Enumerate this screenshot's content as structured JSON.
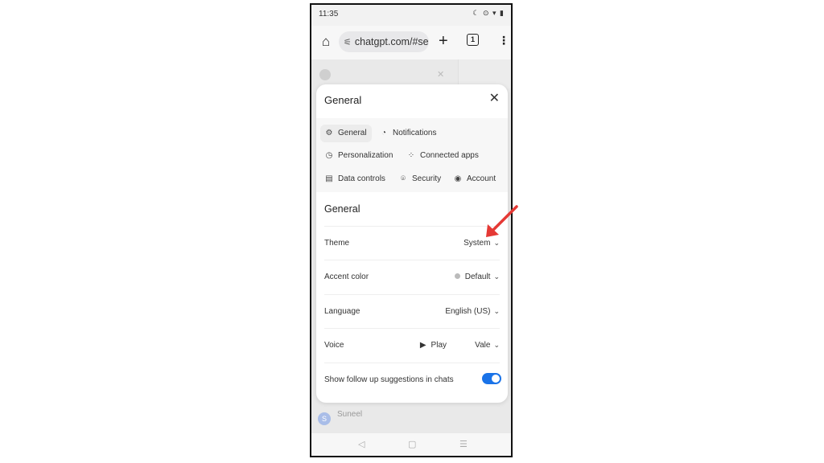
{
  "status_bar": {
    "time": "11:35",
    "icons": "☾ ⊙ ▾ ▮"
  },
  "browser": {
    "url": "chatgpt.com/#se",
    "tab_count": "1"
  },
  "modal": {
    "title": "General",
    "tabs": [
      {
        "label": "General",
        "icon": "gear-icon",
        "glyph": "⚙"
      },
      {
        "label": "Notifications",
        "icon": "bell-icon",
        "glyph": "🔔︎"
      },
      {
        "label": "Personalization",
        "icon": "clock-icon",
        "glyph": "◷"
      },
      {
        "label": "Connected apps",
        "icon": "apps-icon",
        "glyph": "⁘"
      },
      {
        "label": "Data controls",
        "icon": "database-icon",
        "glyph": "▤"
      },
      {
        "label": "Security",
        "icon": "fingerprint-icon",
        "glyph": "⌾"
      },
      {
        "label": "Account",
        "icon": "account-icon",
        "glyph": "◉"
      }
    ],
    "section_title": "General",
    "settings": {
      "theme": {
        "label": "Theme",
        "value": "System"
      },
      "accent": {
        "label": "Accent color",
        "value": "Default",
        "dot_color": "#bbbbbb"
      },
      "language": {
        "label": "Language",
        "value": "English (US)"
      },
      "voice": {
        "label": "Voice",
        "play": "Play",
        "value": "Vale"
      },
      "follow_up": {
        "label": "Show follow up suggestions in chats",
        "enabled": true
      }
    }
  },
  "background": {
    "user_name": "Suneel",
    "user_initial": "S"
  },
  "colors": {
    "toggle": "#1a73e8",
    "annotation_arrow": "#e53935"
  }
}
